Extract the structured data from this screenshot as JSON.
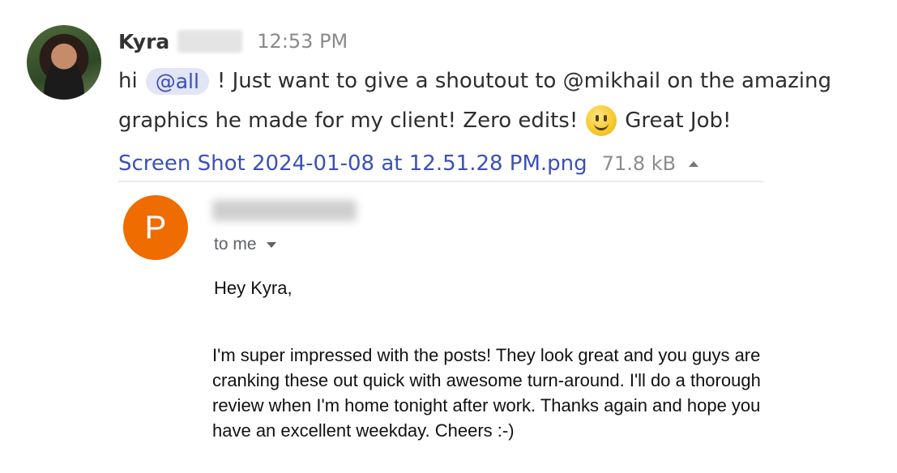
{
  "chat_message": {
    "sender_name": "Kyra",
    "timestamp": "12:53 PM",
    "text_prefix": "hi",
    "mention": "@all",
    "text_line1_rest": "! Just want to give a shoutout to @mikhail on the amazing",
    "text_line2_start": "graphics he made for my client! Zero edits!",
    "emoji_icon": "smiling-face-icon",
    "text_line2_end": "Great Job!"
  },
  "attachment": {
    "filename": "Screen Shot 2024-01-08 at 12.51.28 PM.png",
    "size": "71.8 kB"
  },
  "email": {
    "avatar_letter": "P",
    "avatar_color": "#ef6c00",
    "to_label": "to me",
    "greeting": "Hey Kyra,",
    "body_lines": [
      "I'm super impressed with the posts! They look great and you guys are",
      "cranking these out quick with awesome turn-around.  I'll do a thorough",
      "review when I'm home tonight after work.  Thanks again and hope you",
      "have an excellent weekday.  Cheers :-)"
    ]
  }
}
